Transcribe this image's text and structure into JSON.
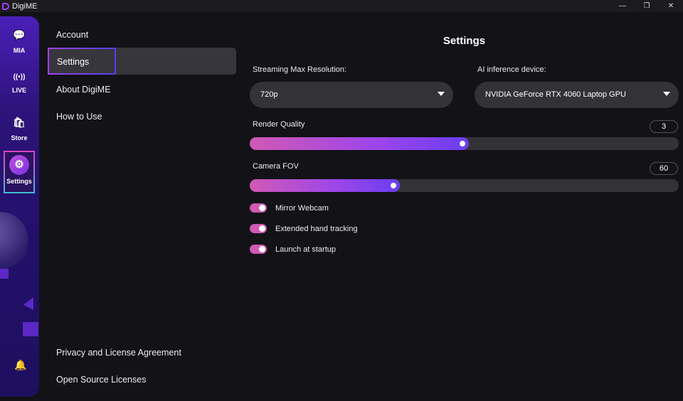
{
  "app": {
    "title": "DigiME",
    "min": "—",
    "restore": "❐",
    "close": "✕"
  },
  "sidebar": {
    "items": [
      {
        "label": "MIA",
        "icon": "💬"
      },
      {
        "label": "LIVE",
        "icon": "((•))"
      },
      {
        "label": "Store",
        "icon": "🛍"
      },
      {
        "label": "Settings",
        "icon": "⚙"
      }
    ],
    "bell": "🔔"
  },
  "menu": {
    "items": [
      "Account",
      "Settings",
      "About DigiME",
      "How to Use"
    ],
    "bottom": [
      "Privacy and License Agreement",
      "Open Source Licenses"
    ]
  },
  "settings": {
    "title": "Settings",
    "resolution": {
      "label": "Streaming Max Resolution:",
      "value": "720p"
    },
    "device": {
      "label": "AI inference device:",
      "value": "NVIDIA GeForce RTX 4060 Laptop GPU"
    },
    "render_quality": {
      "label": "Render Quality",
      "value": "3",
      "fill_percent": 51
    },
    "camera_fov": {
      "label": "Camera FOV",
      "value": "60",
      "fill_percent": 35
    },
    "toggles": [
      {
        "label": "Mirror Webcam",
        "on": true
      },
      {
        "label": "Extended hand tracking",
        "on": true
      },
      {
        "label": "Launch at startup",
        "on": true
      }
    ]
  },
  "colors": {
    "accent_pink": "#d05ab4",
    "accent_purple": "#6a3ef0"
  }
}
